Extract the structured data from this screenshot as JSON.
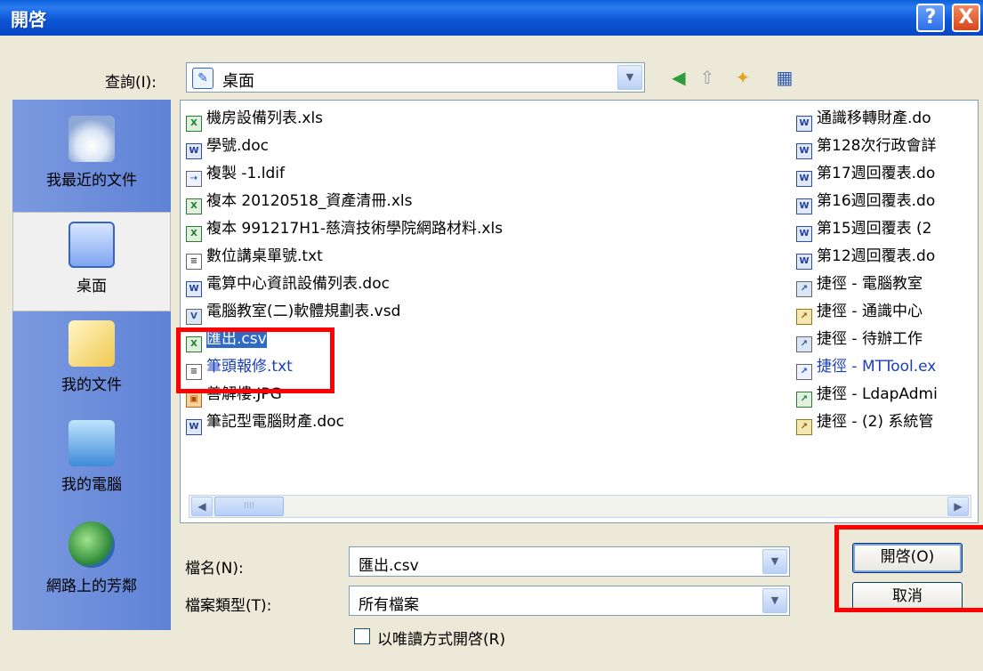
{
  "window": {
    "title": "開啓",
    "help_glyph": "?",
    "close_glyph": "X"
  },
  "lookin": {
    "label": "查詢(I):",
    "value": "桌面"
  },
  "places": [
    {
      "label": "我最近的文件",
      "icon": "recent-documents-icon"
    },
    {
      "label": "桌面",
      "icon": "desktop-icon"
    },
    {
      "label": "我的文件",
      "icon": "my-documents-icon"
    },
    {
      "label": "我的電腦",
      "icon": "my-computer-icon"
    },
    {
      "label": "網路上的芳鄰",
      "icon": "network-places-icon"
    }
  ],
  "files_left": [
    {
      "name": "機房設備列表.xls",
      "type": "xls"
    },
    {
      "name": "學號.doc",
      "type": "doc"
    },
    {
      "name": "複製 -1.ldif",
      "type": "ldif"
    },
    {
      "name": "複本 20120518_資產清冊.xls",
      "type": "xls"
    },
    {
      "name": "複本 991217H1-慈濟技術學院網路材料.xls",
      "type": "xls"
    },
    {
      "name": "數位講桌單號.txt",
      "type": "txt"
    },
    {
      "name": "電算中心資訊設備列表.doc",
      "type": "doc"
    },
    {
      "name": "電腦教室(二)軟體規劃表.vsd",
      "type": "vsd"
    },
    {
      "name": "匯出.csv",
      "type": "xls",
      "selected": true
    },
    {
      "name": "筆頭報修.txt",
      "type": "txt"
    },
    {
      "name": "善解樓.JPG",
      "type": "jpg"
    },
    {
      "name": "筆記型電腦財產.doc",
      "type": "doc"
    }
  ],
  "files_right": [
    {
      "name": "通識移轉財產.do",
      "type": "doc"
    },
    {
      "name": "第128次行政會詳",
      "type": "doc"
    },
    {
      "name": "第17週回覆表.do",
      "type": "doc"
    },
    {
      "name": "第16週回覆表.do",
      "type": "doc"
    },
    {
      "name": "第15週回覆表 (2",
      "type": "doc"
    },
    {
      "name": "第12週回覆表.do",
      "type": "doc"
    },
    {
      "name": "捷徑 - 電腦教室",
      "type": "lnk"
    },
    {
      "name": "捷徑 - 通識中心",
      "type": "lnk"
    },
    {
      "name": "捷徑 - 待辦工作",
      "type": "lnk"
    },
    {
      "name": "捷徑 - MTTool.ex",
      "type": "lnk"
    },
    {
      "name": "捷徑 - LdapAdmi",
      "type": "lnk"
    },
    {
      "name": "捷徑 - (2) 系統管",
      "type": "lnk"
    }
  ],
  "filename": {
    "label": "檔名(N):",
    "value": "匯出.csv"
  },
  "filetype": {
    "label": "檔案類型(T):",
    "value": "所有檔案"
  },
  "readonly": {
    "label": "以唯讀方式開啓(R)"
  },
  "buttons": {
    "open": "開啓(O)",
    "cancel": "取消"
  },
  "icons": {
    "dropdown": "▼",
    "back": "◀",
    "up": "⇧",
    "new_folder": "✦",
    "views": "▦",
    "scroll_left": "◀",
    "scroll_right": "▶",
    "thumb_grip": "IIII"
  }
}
